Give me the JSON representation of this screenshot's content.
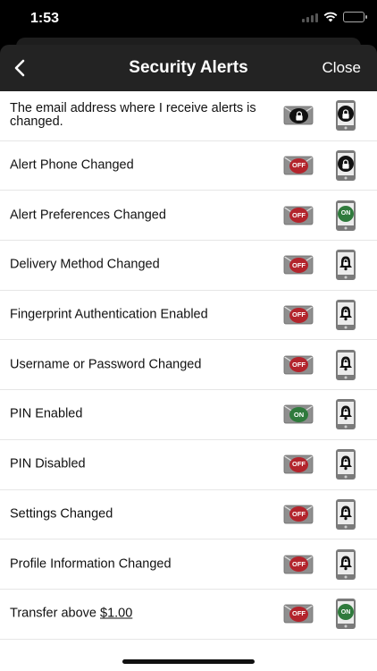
{
  "status_bar": {
    "time": "1:53"
  },
  "nav": {
    "title": "Security Alerts",
    "close_label": "Close"
  },
  "toggle_text": {
    "off": "OFF",
    "on": "ON"
  },
  "colors": {
    "off": "#b3242c",
    "on": "#2f7a3c",
    "nav_bg": "#232323",
    "envelope": "#8f8f8f",
    "phone": "#7a7a7a"
  },
  "alerts": [
    {
      "label": "The email address where I receive alerts is changed.",
      "email": "locked",
      "phone": "locked"
    },
    {
      "label": "Alert Phone Changed",
      "email": "off",
      "phone": "locked"
    },
    {
      "label": "Alert Preferences Changed",
      "email": "off",
      "phone": "on"
    },
    {
      "label": "Delivery Method Changed",
      "email": "off",
      "phone": "locked-bell"
    },
    {
      "label": "Fingerprint Authentication Enabled",
      "email": "off",
      "phone": "locked-bell"
    },
    {
      "label": "Username or Password Changed",
      "email": "off",
      "phone": "locked-bell"
    },
    {
      "label": "PIN Enabled",
      "email": "on",
      "phone": "locked-bell"
    },
    {
      "label": "PIN Disabled",
      "email": "off",
      "phone": "locked-bell"
    },
    {
      "label": "Settings Changed",
      "email": "off",
      "phone": "locked-bell"
    },
    {
      "label": "Profile Information Changed",
      "email": "off",
      "phone": "locked-bell"
    },
    {
      "label": "Transfer above",
      "amount": "$1.00",
      "email": "off",
      "phone": "on"
    }
  ]
}
